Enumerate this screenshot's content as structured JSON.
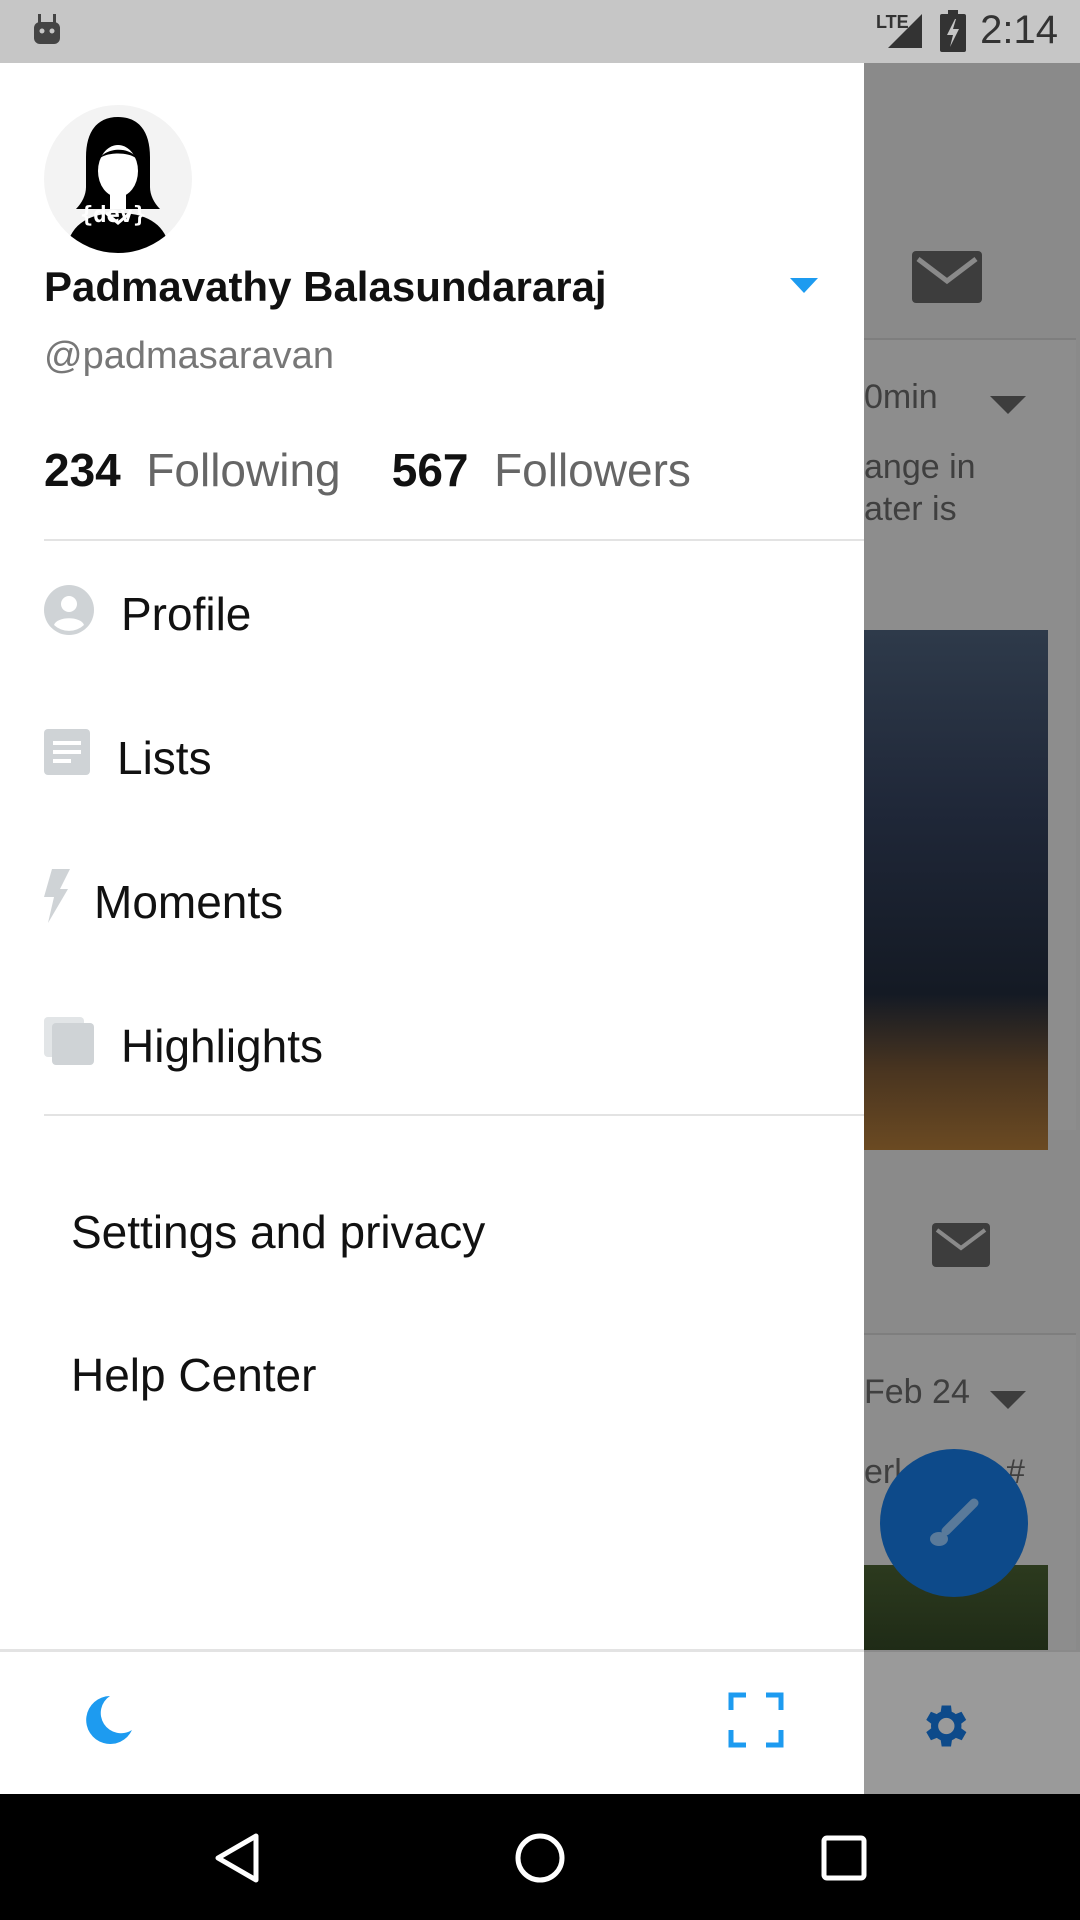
{
  "status_bar": {
    "time": "2:14",
    "network": "LTE"
  },
  "background_feed": {
    "time_ago_1": "0min",
    "snippet_line_1": "ange in",
    "snippet_line_2": "ater is",
    "date_2": "Feb 24",
    "snippet_2": "erl",
    "hash": "#"
  },
  "drawer": {
    "avatar_text": "{dev}",
    "display_name": "Padmavathy Balasundararaj",
    "handle": "@padmasaravan",
    "following_count": "234",
    "following_label": "Following",
    "followers_count": "567",
    "followers_label": "Followers",
    "menu": [
      {
        "label": "Profile",
        "icon": "profile-icon"
      },
      {
        "label": "Lists",
        "icon": "lists-icon"
      },
      {
        "label": "Moments",
        "icon": "lightning-icon"
      },
      {
        "label": "Highlights",
        "icon": "highlights-icon"
      }
    ],
    "secondary": [
      {
        "label": "Settings and privacy"
      },
      {
        "label": "Help Center"
      }
    ],
    "footer": {
      "night_mode_icon": "moon-icon",
      "scan_icon": "qr-scan-icon"
    }
  },
  "colors": {
    "accent": "#1d9bf0",
    "fab": "#0d4a8a",
    "icon_gray": "#cfd3d6"
  }
}
